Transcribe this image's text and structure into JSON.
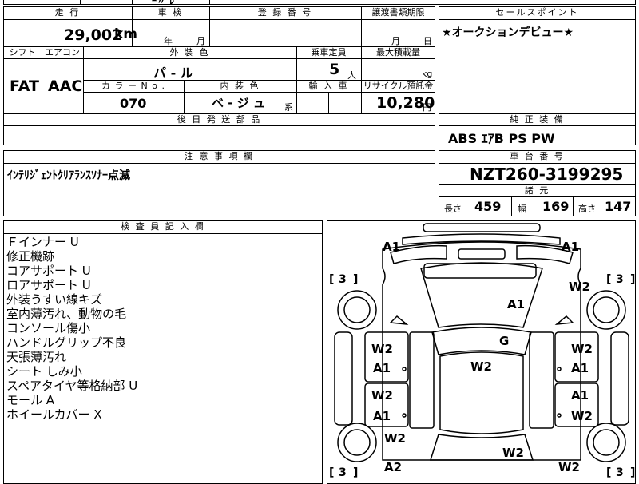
{
  "top_cut": {
    "model_partial": "ｰ〃 ﾚ"
  },
  "mileage": {
    "header": "走 行",
    "value": "29,002",
    "unit": "km"
  },
  "inspection": {
    "header": "車 検",
    "year_label": "年",
    "month_label": "月"
  },
  "registration": {
    "header": "登 録 番 号"
  },
  "transfer": {
    "header": "譲渡書類期限",
    "month_label": "月",
    "day_label": "日"
  },
  "sales_point": {
    "header": "セールスポイント",
    "text": "★オークションデビュー★"
  },
  "shift": {
    "header": "シフト",
    "value": "FAT"
  },
  "aircon": {
    "header": "エアコン",
    "value": "AAC"
  },
  "exterior": {
    "header": "外 装 色",
    "value": "パ - ル"
  },
  "capacity": {
    "header": "乗車定員",
    "value": "5",
    "unit": "人"
  },
  "max_load": {
    "header": "最大積載量",
    "unit": "kg"
  },
  "color_no": {
    "header": "カ ラ ー N o .",
    "value": "070"
  },
  "interior": {
    "header": "内 装 色",
    "value": "ベ - ジ ュ",
    "suffix": "系"
  },
  "import": {
    "header": "輸 入 車"
  },
  "recycle": {
    "header": "リサイクル預託金",
    "value": "10,280",
    "unit": "円"
  },
  "later_parts": {
    "header": "後 日 発 送 部 品"
  },
  "equipment": {
    "header": "純 正 装 備",
    "value": "ABS ｴｱB PS PW"
  },
  "caution": {
    "header": "注 意 事 項 欄",
    "text": "ｲﾝﾃﾘｼﾞｪﾝﾄｸﾘｱﾗﾝｽｿﾅｰ点滅"
  },
  "chassis": {
    "header": "車 台 番 号",
    "value": "NZT260-3199295"
  },
  "specs": {
    "header": "諸 元",
    "length_label": "長さ",
    "length": "459",
    "width_label": "幅",
    "width": "169",
    "height_label": "高さ",
    "height": "147"
  },
  "inspector": {
    "header": "検 査 員 記 入 欄",
    "notes": [
      "Ｆインナー U",
      "修正機跡",
      "コアサポート U",
      "ロアサポート U",
      "外装うすい線キズ",
      "室内薄汚れ、動物の毛",
      "コンソール傷小",
      "ハンドルグリップ不良",
      "天張薄汚れ",
      "シート しみ小",
      "スペアタイヤ等格納部 U",
      "モール A",
      "ホイールカバー X"
    ]
  },
  "diagram": {
    "marks": {
      "front_left": "A1",
      "front_right": "A1",
      "hood": "A1",
      "windshield_area": "G",
      "roof": "W2",
      "front_left_fender": "W2",
      "front_right_fender": "W2",
      "front_door_left_top": "W2",
      "front_door_left_bottom": "A1",
      "front_door_right_top": "W2",
      "front_door_right_bottom": "A1",
      "rear_door_left_top": "W2",
      "rear_door_left_bottom": "A1",
      "rear_door_right_top": "A1",
      "rear_door_right_bottom": "W2",
      "rear_left_fender": "W2",
      "rear_left_quarter": "A2",
      "trunk": "W2",
      "rear_right_quarter": "W2",
      "tire_fl": "3",
      "tire_fr": "3",
      "tire_rl": "3",
      "tire_rr": "3"
    }
  }
}
